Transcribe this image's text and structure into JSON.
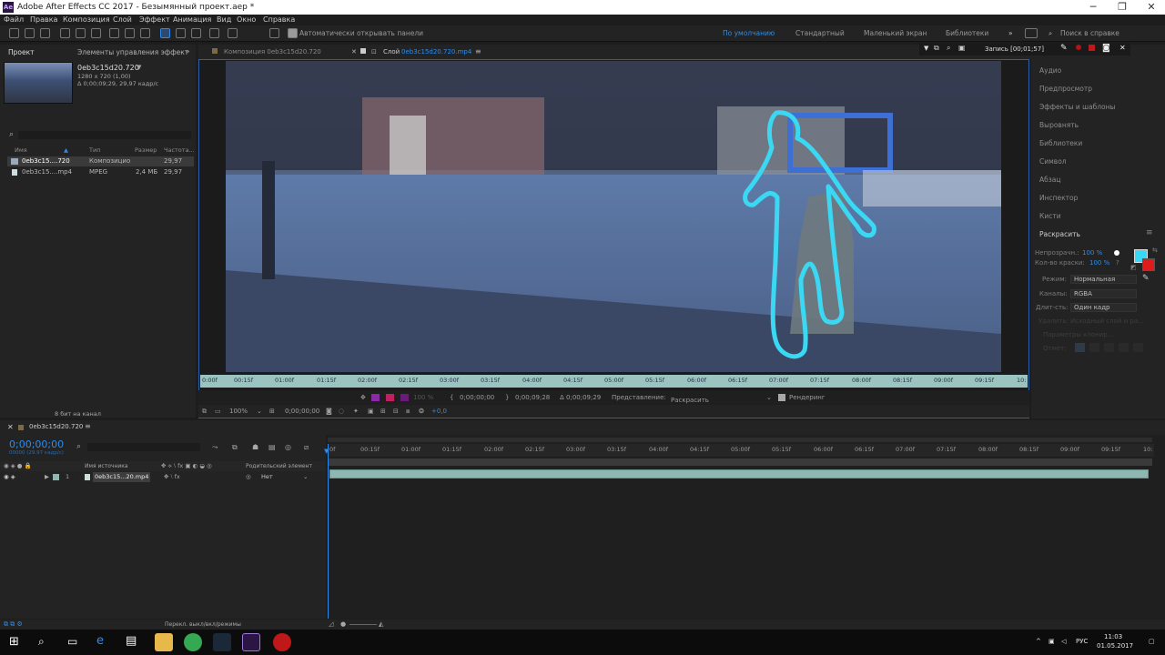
{
  "window": {
    "title": "Adobe After Effects CC 2017 - Безымянный проект.aep *",
    "logo_text": "Ae",
    "minimize": "─",
    "maximize": "❐",
    "close": "✕"
  },
  "menu": [
    "Файл",
    "Правка",
    "Композиция",
    "Слой",
    "Эффект",
    "Анимация",
    "Вид",
    "Окно",
    "Справка"
  ],
  "toolbar": {
    "auto_open_panels": "Автоматически открывать панели",
    "workspaces": [
      "По умолчанию",
      "Стандартный",
      "Маленький экран",
      "Библиотеки"
    ],
    "search_help": "Поиск в справке"
  },
  "project_panel": {
    "tabs": [
      "Проект",
      "Элементы управления эффект"
    ],
    "selected_name": "0eb3c15d20.720",
    "selected_info_1": "1280 x 720 (1,00)",
    "selected_info_2": "Δ 0;00;09;29, 29,97 кадр/с",
    "columns": [
      "Имя",
      "Тип",
      "Размер",
      "Частота..."
    ],
    "rows": [
      {
        "name": "0eb3c15....720",
        "type": "Композицио",
        "size": "",
        "fps": "29,97"
      },
      {
        "name": "0eb3c15....mp4",
        "type": "MPEG",
        "size": "2,4 МБ",
        "fps": "29,97"
      }
    ],
    "bit_depth": "8 бит на канал"
  },
  "viewer": {
    "tab_comp": "Композиция 0eb3c15d20.720",
    "tab_layer_prefix": "Слой",
    "tab_layer_name": "0eb3c15d20.720.mp4",
    "record_label": "Запись [00;01;57]",
    "ruler_ticks": [
      "0:00f",
      "00:15f",
      "01:00f",
      "01:15f",
      "02:00f",
      "02:15f",
      "03:00f",
      "03:15f",
      "04:00f",
      "04:15f",
      "05:00f",
      "05:15f",
      "06:00f",
      "06:15f",
      "07:00f",
      "07:15f",
      "08:00f",
      "08:15f",
      "09:00f",
      "09:15f",
      "10:"
    ],
    "time_start": "0;00;00;00",
    "time_end": "0;00;09;28",
    "time_duration": "Δ 0;00;09;29",
    "view_label": "Представление:",
    "view_value": "Раскрасить",
    "render_label": "Рендеринг",
    "opacity_small": "100 %",
    "zoom": "100%",
    "bottom_time": "0;00;00;00",
    "exposure": "+0,0"
  },
  "right_panel": {
    "items": [
      "Аудио",
      "Предпросмотр",
      "Эффекты и шаблоны",
      "Выровнять",
      "Библиотеки",
      "Символ",
      "Абзац",
      "Инспектор",
      "Кисти"
    ],
    "paint_title": "Раскрасить",
    "opacity_label": "Непрозрачн.:",
    "opacity_value": "100 %",
    "flow_label": "Кол-во краски:",
    "flow_value": "100 %",
    "mode_label": "Режим:",
    "mode_value": "Нормальная",
    "channels_label": "Каналы:",
    "channels_value": "RGBA",
    "duration_label": "Длит-сть:",
    "duration_value": "Один кадр",
    "erase_label": "Удалить:",
    "erase_value": "Исходный слой и ра...",
    "clone_label": "Параметры клонир...",
    "preset_label": "Отмет:",
    "foreground_color": "#3ad8f3",
    "background_color": "#e01b1b"
  },
  "timeline": {
    "comp_tab": "0eb3c15d20.720",
    "current_time": "0;00;00;00",
    "current_frame": "00000 (29.97 кадр/с)",
    "col_source": "Имя источника",
    "col_parent": "Родительский элемент",
    "layer_num": "1",
    "layer_name": "0eb3c15...20.mp4",
    "parent_value": "Нет",
    "ruler_ticks": [
      "0f",
      "00:15f",
      "01:00f",
      "01:15f",
      "02:00f",
      "02:15f",
      "03:00f",
      "03:15f",
      "04:00f",
      "04:15f",
      "05:00f",
      "05:15f",
      "06:00f",
      "06:15f",
      "07:00f",
      "07:15f",
      "08:00f",
      "08:15f",
      "09:00f",
      "09:15f",
      "10:"
    ],
    "status_toggle": "Перекл. выкл/вкл/режимы"
  },
  "taskbar": {
    "tray_lang": "РУС",
    "clock_time": "11:03",
    "clock_date": "01.05.2017"
  },
  "colors": {
    "accent": "#2d8ceb",
    "brush_stroke": "#3ad8f3",
    "ruler": "#9bc3c0"
  }
}
